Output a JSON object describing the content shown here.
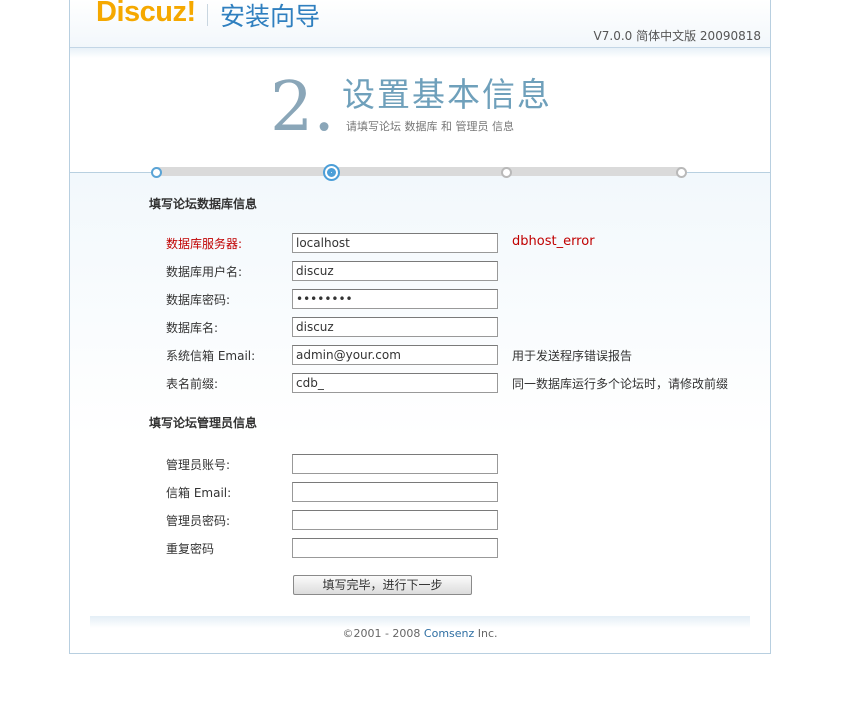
{
  "header": {
    "logo": "Discuz!",
    "title": "安装向导",
    "version": "V7.0.0 简体中文版 20090818"
  },
  "step": {
    "number": "2.",
    "title": "设置基本信息",
    "subtitle": "请填写论坛 数据库 和 管理员 信息",
    "progress": {
      "total": 4,
      "current": 2
    }
  },
  "db_section": {
    "title": "填写论坛数据库信息",
    "fields": [
      {
        "label": "数据库服务器:",
        "value": "localhost",
        "note": "dbhost_error",
        "error": true
      },
      {
        "label": "数据库用户名:",
        "value": "discuz",
        "note": ""
      },
      {
        "label": "数据库密码:",
        "value": "discuzpw",
        "note": "",
        "type": "password"
      },
      {
        "label": "数据库名:",
        "value": "discuz",
        "note": ""
      },
      {
        "label": "系统信箱 Email:",
        "value": "admin@your.com",
        "note": "用于发送程序错误报告"
      },
      {
        "label": "表名前缀:",
        "value": "cdb_",
        "note": "同一数据库运行多个论坛时，请修改前缀"
      }
    ]
  },
  "admin_section": {
    "title": "填写论坛管理员信息",
    "fields": [
      {
        "label": "管理员账号:",
        "value": ""
      },
      {
        "label": "信箱 Email:",
        "value": ""
      },
      {
        "label": "管理员密码:",
        "value": ""
      },
      {
        "label": "重复密码",
        "value": ""
      }
    ]
  },
  "submit_label": "填写完毕，进行下一步",
  "footer": {
    "copyright": "©2001 - 2008",
    "company": "Comsenz",
    "suffix": "Inc."
  },
  "colors": {
    "logo": "#f5a800",
    "accent": "#4d9fd8",
    "error": "#c00000"
  }
}
